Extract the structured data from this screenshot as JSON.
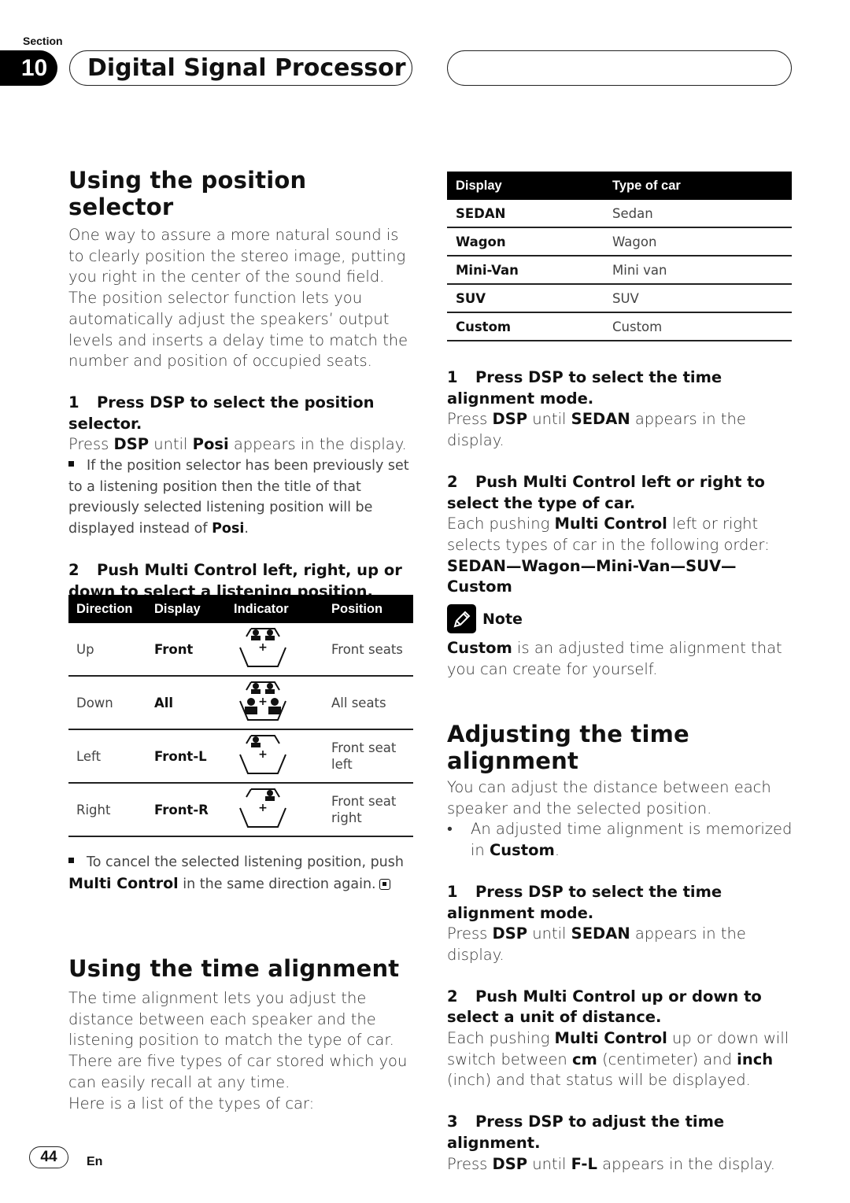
{
  "header": {
    "section_label": "Section",
    "section_number": "10",
    "chapter_title": "Digital Signal Processor"
  },
  "position_selector": {
    "title": "Using the position selector",
    "intro": "One way to assure a more natural sound is to clearly position the stereo image, putting you right in the center of the sound field. The position selector function lets you automatically adjust the speakers’ output levels and inserts a delay time to match the number and position of occupied seats.",
    "step1": {
      "number": "1",
      "heading": "Press DSP to select the position selector.",
      "body_pre": "Press ",
      "body_b1": "DSP",
      "body_mid": " until ",
      "body_b2": "Posi",
      "body_post": " appears in the display.",
      "note_pre": "If the position selector has been previously set to a listening position then the title of that previously selected listening position will be displayed instead of ",
      "note_b": "Posi",
      "note_post": "."
    },
    "step2": {
      "number": "2",
      "heading": "Push Multi Control left, right, up or down to select a listening position."
    },
    "table": {
      "headers": [
        "Direction",
        "Display",
        "Indicator",
        "Position"
      ],
      "rows": [
        {
          "direction": "Up",
          "display": "Front",
          "indicator": "front-seats-icon",
          "position": "Front seats"
        },
        {
          "direction": "Down",
          "display": "All",
          "indicator": "all-seats-icon",
          "position": "All seats"
        },
        {
          "direction": "Left",
          "display": "Front-L",
          "indicator": "front-left-seat-icon",
          "position": "Front seat left"
        },
        {
          "direction": "Right",
          "display": "Front-R",
          "indicator": "front-right-seat-icon",
          "position": "Front seat right"
        }
      ]
    },
    "cancel_note_pre": "To cancel the selected listening position, push ",
    "cancel_note_b": "Multi Control",
    "cancel_note_post": " in the same direction again."
  },
  "time_alignment": {
    "title": "Using the time alignment",
    "intro": "The time alignment lets you adjust the distance between each speaker and the listening position to match the type of car. There are five types of car stored which you can easily recall at any time.",
    "list_intro": "Here is a list of the types of car:",
    "table": {
      "headers": [
        "Display",
        "Type of car"
      ],
      "rows": [
        {
          "display": "SEDAN",
          "type": "Sedan"
        },
        {
          "display": "Wagon",
          "type": "Wagon"
        },
        {
          "display": "Mini-Van",
          "type": "Mini van"
        },
        {
          "display": "SUV",
          "type": "SUV"
        },
        {
          "display": "Custom",
          "type": "Custom"
        }
      ]
    },
    "step1": {
      "number": "1",
      "heading": "Press DSP to select the time alignment mode.",
      "body_pre": "Press ",
      "body_b1": "DSP",
      "body_mid": " until ",
      "body_b2": "SEDAN",
      "body_post": " appears in the display."
    },
    "step2": {
      "number": "2",
      "heading": "Push Multi Control left or right to select the type of car.",
      "body_pre": "Each pushing ",
      "body_b": "Multi Control",
      "body_post": " left or right selects types of car in the following order:",
      "order": "SEDAN—Wagon—Mini-Van—SUV—Custom"
    },
    "note": {
      "label": "Note",
      "text_b": "Custom",
      "text_post": " is an adjusted time alignment that you can create for yourself."
    }
  },
  "adjusting": {
    "title": "Adjusting the time alignment",
    "intro": "You can adjust the distance between each speaker and the selected position.",
    "bullet_pre": "An adjusted time alignment is memorized in ",
    "bullet_b": "Custom",
    "bullet_post": ".",
    "step1": {
      "number": "1",
      "heading": "Press DSP to select the time alignment mode.",
      "body_pre": "Press ",
      "body_b1": "DSP",
      "body_mid": " until ",
      "body_b2": "SEDAN",
      "body_post": " appears in the display."
    },
    "step2": {
      "number": "2",
      "heading": "Push Multi Control up or down to select a unit of distance.",
      "body_pre": "Each pushing ",
      "body_b1": "Multi Control",
      "body_mid1": " up or down will switch between ",
      "body_b2": "cm",
      "body_mid2": " (centimeter) and ",
      "body_b3": "inch",
      "body_post": " (inch) and that status will be displayed."
    },
    "step3": {
      "number": "3",
      "heading": "Press DSP to adjust the time alignment.",
      "body_pre": "Press ",
      "body_b1": "DSP",
      "body_mid": " until ",
      "body_b2": "F-L",
      "body_post": " appears in the display."
    }
  },
  "footer": {
    "page_number": "44",
    "language": "En"
  }
}
